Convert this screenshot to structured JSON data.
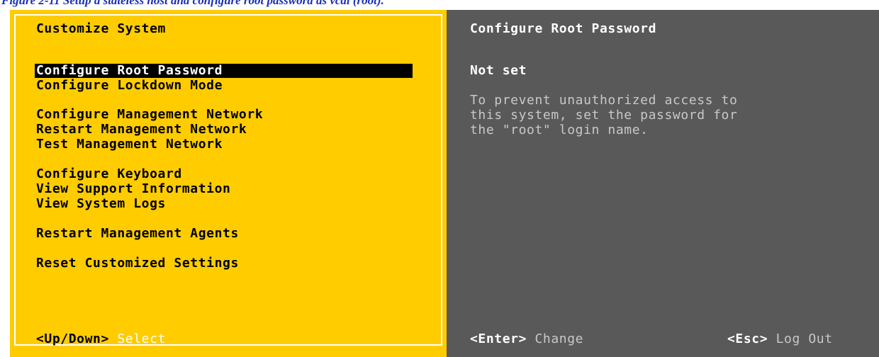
{
  "caption": {
    "text": "Figure 2-11 Setup a stateless host and configure root password as vcai (root)."
  },
  "left_pane": {
    "title": "Customize System",
    "menu_items": [
      {
        "label": "Configure Root Password",
        "selected": true
      },
      {
        "label": "Configure Lockdown Mode",
        "selected": false
      },
      {
        "label": "Configure Management Network",
        "selected": false
      },
      {
        "label": "Restart Management Network",
        "selected": false
      },
      {
        "label": "Test Management Network",
        "selected": false
      },
      {
        "label": "Configure Keyboard",
        "selected": false
      },
      {
        "label": "View Support Information",
        "selected": false
      },
      {
        "label": "View System Logs",
        "selected": false
      },
      {
        "label": "Restart Management Agents",
        "selected": false
      },
      {
        "label": "Reset Customized Settings",
        "selected": false
      }
    ],
    "footer": {
      "key": "<Up/Down>",
      "hint": "Select"
    }
  },
  "right_pane": {
    "title": "Configure Root Password",
    "status": "Not set",
    "help_lines": [
      "To prevent unauthorized access to",
      "this system, set the password for",
      "the \"root\" login name."
    ],
    "footer_change": {
      "key": "<Enter>",
      "hint": "Change"
    },
    "footer_logout": {
      "key": "<Esc>",
      "hint": "Log Out"
    }
  },
  "colors": {
    "left_background": "#ffcc00",
    "right_background": "#595959",
    "selection": "#000000",
    "caption": "#1a2fb5"
  }
}
